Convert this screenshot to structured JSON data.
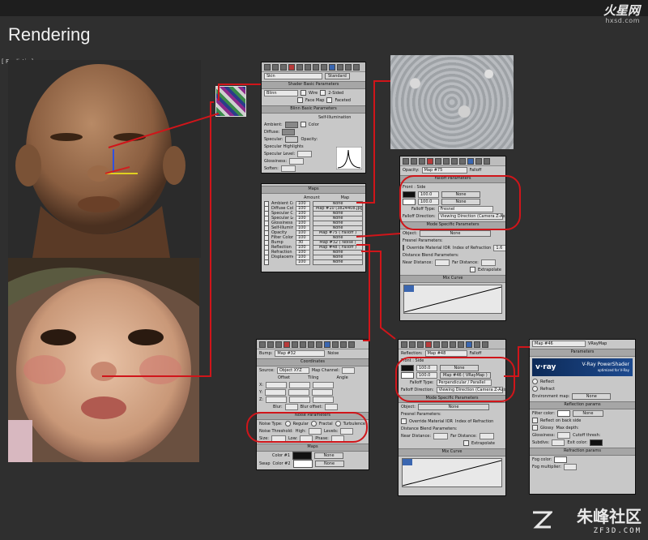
{
  "title": "Rendering",
  "viewport_label": "[ Realistic ]",
  "logo_top": {
    "cn": "火星网",
    "en": "hxsd.com"
  },
  "logo_bottom": {
    "cn": "朱峰社区",
    "en": "ZF3D.COM"
  },
  "panel_main": {
    "map_name": "Skin",
    "standard": "Standard",
    "shader_basic": "Shader Basic Parameters",
    "shader_type": "Blinn",
    "wire": "Wire",
    "two_sided": "2-Sided",
    "face_map": "Face Map",
    "faceted": "Faceted",
    "blinn_basic": "Blinn Basic Parameters",
    "self_illum": "Self-Illumination",
    "ambient": "Ambient:",
    "diffuse": "Diffuse:",
    "specular": "Specular:",
    "color": "Color",
    "opacity": "Opacity:",
    "spec_highlights": "Specular Highlights",
    "spec_level": "Specular Level:",
    "glossiness": "Glossiness:",
    "soften": "Soften:"
  },
  "panel_maps": {
    "header": "Maps",
    "amount": "Amount",
    "map": "Map",
    "rows": [
      {
        "name": "Ambient Color",
        "amount": "100",
        "map": "None"
      },
      {
        "name": "Diffuse Color",
        "amount": "100",
        "map": "Map #10 (3824408.jpg)"
      },
      {
        "name": "Specular Color",
        "amount": "100",
        "map": "None"
      },
      {
        "name": "Specular Level",
        "amount": "100",
        "map": "None"
      },
      {
        "name": "Glossiness",
        "amount": "100",
        "map": "None"
      },
      {
        "name": "Self-Illumination",
        "amount": "100",
        "map": "None"
      },
      {
        "name": "Opacity",
        "amount": "100",
        "map": "Map #75 ( Falloff )"
      },
      {
        "name": "Filter Color",
        "amount": "100",
        "map": "None"
      },
      {
        "name": "Bump",
        "amount": "30",
        "map": "Map #32 ( Noise )"
      },
      {
        "name": "Reflection",
        "amount": "100",
        "map": "Map #48 ( Falloff )"
      },
      {
        "name": "Refraction",
        "amount": "100",
        "map": "None"
      },
      {
        "name": "Displacement",
        "amount": "100",
        "map": "None"
      },
      {
        "name": "",
        "amount": "100",
        "map": "None"
      }
    ]
  },
  "panel_falloff1": {
    "opacity": "Opacity:",
    "map_name": "Map #75",
    "type": "Falloff",
    "params": "Falloff Parameters",
    "front_side": "Front : Side",
    "val1": "100.0",
    "val2": "100.0",
    "none": "None",
    "falloff_type_label": "Falloff Type:",
    "falloff_type": "Fresnel",
    "falloff_dir_label": "Falloff Direction:",
    "falloff_dir": "Viewing Direction (Camera Z-Axis)",
    "mode_specific": "Mode Specific Parameters",
    "object": "Object:",
    "fresnel_params": "Fresnel Parameters:",
    "override": "Override Material IOR",
    "ior_label": "Index of Refraction",
    "ior": "1.6",
    "distance_blend": "Distance Blend Parameters:",
    "near": "Near Distance:",
    "far": "Far Distance:",
    "extrapolate": "Extrapolate",
    "mix_curve": "Mix Curve"
  },
  "panel_noise": {
    "bump": "Bump:",
    "map_name": "Map #32",
    "type": "Noise",
    "coordinates": "Coordinates",
    "source": "Source:",
    "source_value": "Object XYZ",
    "map_channel": "Map Channel:",
    "offset": "Offset",
    "tiling": "Tiling",
    "angle": "Angle",
    "x": "X:",
    "y": "Y:",
    "z": "Z:",
    "blur": "Blur:",
    "blur_offset": "Blur offset:",
    "noise_params": "Noise Parameters",
    "noise_type": "Noise Type:",
    "regular": "Regular",
    "fractal": "Fractal",
    "turbulence": "Turbulence",
    "noise_threshold": "Noise Threshold:",
    "high": "High:",
    "levels": "Levels:",
    "size": "Size:",
    "low": "Low:",
    "phase": "Phase:",
    "maps": "Maps",
    "swap": "Swap",
    "color1": "Color #1",
    "color2": "Color #2",
    "none": "None"
  },
  "panel_falloff2": {
    "reflection": "Reflection:",
    "map_name": "Map #48",
    "type": "Falloff",
    "front_side": "Front : Side",
    "val1": "100.0",
    "val2": "100.0",
    "none": "None",
    "map_ref": "Map #46 ( VRayMap )",
    "falloff_type_label": "Falloff Type:",
    "falloff_type": "Perpendicular / Parallel",
    "falloff_dir_label": "Falloff Direction:",
    "falloff_dir": "Viewing Direction (Camera Z-Axis)",
    "mode_specific": "Mode Specific Parameters",
    "object": "Object:",
    "fresnel_params": "Fresnel Parameters:",
    "override": "Override Material IOR",
    "ior_label": "Index of Refraction",
    "distance_blend": "Distance Blend Parameters:",
    "near": "Near Distance:",
    "far": "Far Distance:",
    "extrapolate": "Extrapolate",
    "mix_curve": "Mix Curve"
  },
  "panel_vray": {
    "map_name": "Map #46",
    "type": "VRayMap",
    "parameters": "Parameters",
    "banner_v": "v·ray",
    "banner_title": "V-Ray PowerShader",
    "banner_sub": "optimized for V-Ray",
    "reflect": "Reflect",
    "refract": "Refract",
    "env_map": "Environment map:",
    "reflection_params": "Reflection params",
    "filter_color": "Filter color:",
    "reflect_backside": "Reflect on back side",
    "glossy": "Glossy",
    "glossiness": "Glossiness:",
    "subdivs": "Subdivs:",
    "max_depth": "Max depth:",
    "cutoff": "Cutoff thresh:",
    "exit_color": "Exit color:",
    "refraction_params": "Refraction params",
    "fog_color": "Fog color:",
    "fog_multiplier": "Fog multiplier:",
    "none": "None"
  }
}
